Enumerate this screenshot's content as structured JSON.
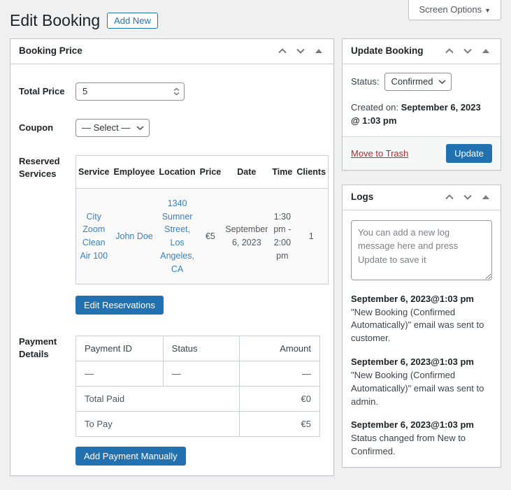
{
  "page": {
    "title": "Edit Booking",
    "add_new_label": "Add New",
    "screen_options_label": "Screen Options"
  },
  "booking_price": {
    "title": "Booking Price",
    "total_price": {
      "label": "Total Price",
      "value": "5"
    },
    "coupon": {
      "label": "Coupon",
      "value": "— Select —"
    },
    "reserved_services": {
      "label": "Reserved Services",
      "headers": [
        "Service",
        "Employee",
        "Location",
        "Price",
        "Date",
        "Time",
        "Clients"
      ],
      "row": {
        "service": "City Zoom Clean Air 100",
        "employee": "John Doe",
        "location": "1340 Sumner Street, Los Angeles, CA",
        "price": "€5",
        "date": "September 6, 2023",
        "time": "1:30 pm - 2:00 pm",
        "clients": "1"
      },
      "edit_button": "Edit Reservations"
    },
    "payment_details": {
      "label": "Payment Details",
      "headers": [
        "Payment ID",
        "Status",
        "Amount"
      ],
      "empty_row": [
        "—",
        "—",
        "—"
      ],
      "total_paid_label": "Total Paid",
      "total_paid_value": "€0",
      "to_pay_label": "To Pay",
      "to_pay_value": "€5",
      "add_button": "Add Payment Manually"
    }
  },
  "update_booking": {
    "title": "Update Booking",
    "status_label": "Status:",
    "status_value": "Confirmed",
    "created_prefix": "Created on:",
    "created_value": "September 6, 2023 @ 1:03 pm",
    "trash_label": "Move to Trash",
    "update_label": "Update"
  },
  "logs": {
    "title": "Logs",
    "placeholder": "You can add a new log message here and press Update to save it",
    "entries": [
      {
        "date": "September 6, 2023@1:03 pm",
        "message": "\"New Booking (Confirmed Automatically)\" email was sent to customer."
      },
      {
        "date": "September 6, 2023@1:03 pm",
        "message": "\"New Booking (Confirmed Automatically)\" email was sent to admin."
      },
      {
        "date": "September 6, 2023@1:03 pm",
        "message": "Status changed from New to Confirmed."
      }
    ]
  },
  "colors": {
    "accent": "#2271b1",
    "danger": "#b32d2e",
    "background": "#f0f0f1",
    "link": "#3582c4"
  }
}
